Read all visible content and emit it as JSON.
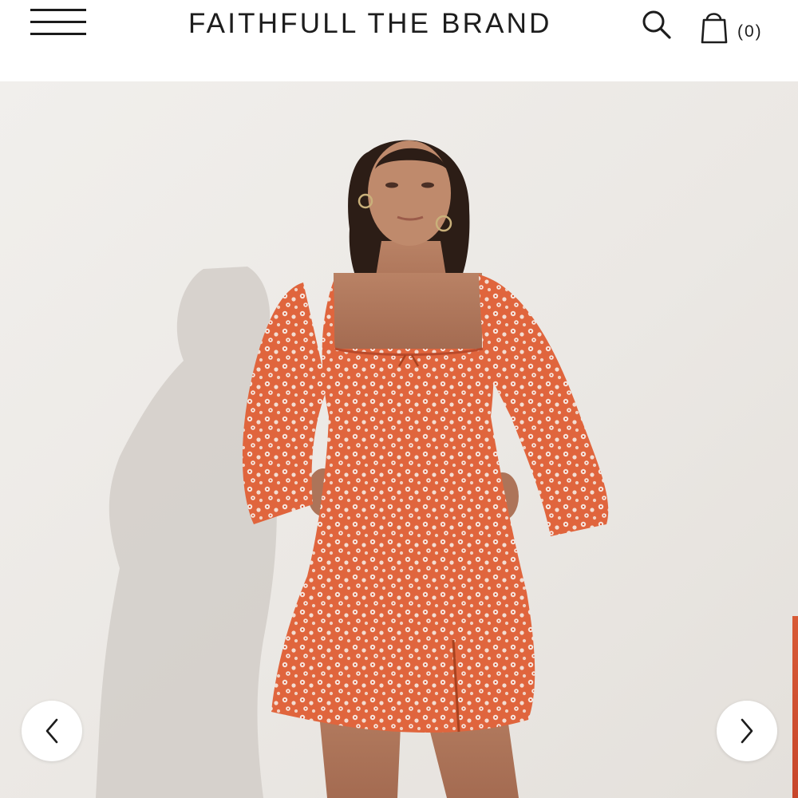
{
  "header": {
    "brand": "FAITHFULL THE BRAND",
    "menu_icon": "hamburger-menu-icon",
    "search_icon": "search-icon",
    "cart_icon": "shopping-bag-icon",
    "cart_count": "(0)"
  },
  "gallery": {
    "image_subject": "model wearing orange floral long-sleeve mini dress",
    "prev_icon": "chevron-left-icon",
    "next_icon": "chevron-right-icon"
  },
  "colors": {
    "text": "#1d1d1d",
    "background": "#ffffff",
    "dress": "#e0653d",
    "wall": "#efece8"
  }
}
